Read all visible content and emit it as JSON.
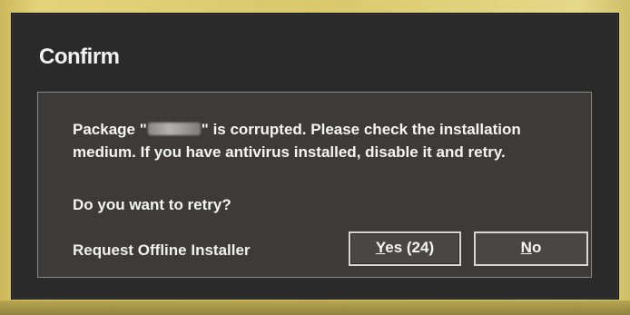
{
  "dialog": {
    "title": "Confirm",
    "message_before_name": "Package \"",
    "message_after_name": "\" is corrupted. Please check the installation medium. If you have antivirus installed, disable it and retry.",
    "question": "Do you want to retry?",
    "offline_link": "Request Offline Installer",
    "yes_button": {
      "accel": "Y",
      "rest": "es (24)"
    },
    "no_button": {
      "accel": "N",
      "rest": "o"
    }
  },
  "colors": {
    "window_bg": "#2a2a2a",
    "panel_bg": "#3d3a39",
    "button_border": "#d8d5d4",
    "text": "#f5f5f5",
    "surround": "#d9c96c"
  }
}
